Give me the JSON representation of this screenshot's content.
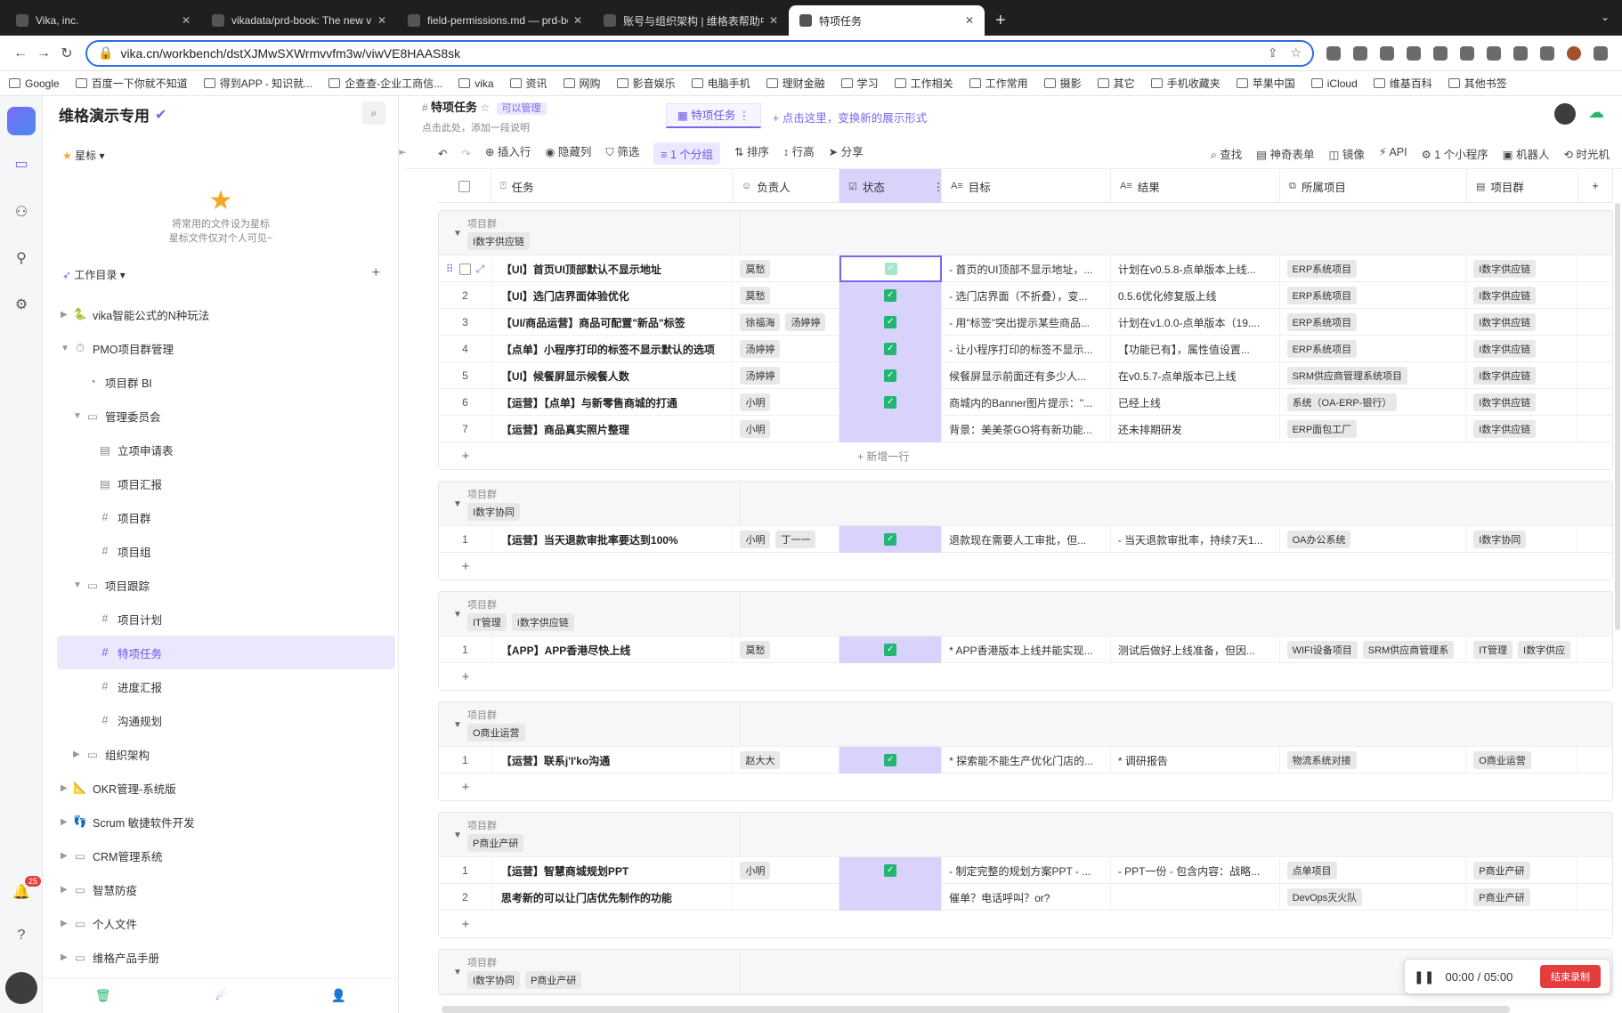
{
  "browser": {
    "tabs": [
      {
        "title": "Vika, inc.",
        "active": false
      },
      {
        "title": "vikadata/prd-book: The new vi",
        "active": false
      },
      {
        "title": "field-permissions.md — prd-bo",
        "active": false
      },
      {
        "title": "账号与组织架构 | 维格表帮助中心",
        "active": false
      },
      {
        "title": "特项任务",
        "active": true
      }
    ],
    "url": "vika.cn/workbench/dstXJMwSXWrmvvfm3w/viwVE8HAAS8sk",
    "bookmarks": [
      "Google",
      "百度一下你就不知道",
      "得到APP - 知识就...",
      "企查查-企业工商信...",
      "vika",
      "资讯",
      "网购",
      "影音娱乐",
      "电脑手机",
      "理财金融",
      "学习",
      "工作相关",
      "工作常用",
      "摄影",
      "其它",
      "手机收藏夹",
      "苹果中国",
      "iCloud",
      "维基百科",
      "其他书签"
    ]
  },
  "sidebar": {
    "space_name": "维格演示专用",
    "star_label": "星标",
    "star_tip_line1": "将常用的文件设为星标",
    "star_tip_line2": "星标文件仅对个人可见~",
    "catalog_label": "工作目录",
    "notification_count": "25",
    "tree": [
      {
        "label": "vika智能公式的N种玩法",
        "level": 0,
        "caret": "▶",
        "icon": "🐍"
      },
      {
        "label": "PMO项目群管理",
        "level": 0,
        "caret": "▼",
        "icon": "⏱"
      },
      {
        "label": "项目群 BI",
        "level": 1,
        "caret": "",
        "icon": "◔"
      },
      {
        "label": "管理委员会",
        "level": 1,
        "caret": "▼",
        "icon": "▭"
      },
      {
        "label": "立项申请表",
        "level": 2,
        "caret": "",
        "icon": "▤"
      },
      {
        "label": "项目汇报",
        "level": 2,
        "caret": "",
        "icon": "▤"
      },
      {
        "label": "项目群",
        "level": 2,
        "caret": "",
        "icon": "#"
      },
      {
        "label": "项目组",
        "level": 2,
        "caret": "",
        "icon": "#"
      },
      {
        "label": "项目跟踪",
        "level": 1,
        "caret": "▼",
        "icon": "▭"
      },
      {
        "label": "项目计划",
        "level": 2,
        "caret": "",
        "icon": "#"
      },
      {
        "label": "特项任务",
        "level": 2,
        "caret": "",
        "icon": "#"
      },
      {
        "label": "进度汇报",
        "level": 2,
        "caret": "",
        "icon": "#"
      },
      {
        "label": "沟通规划",
        "level": 2,
        "caret": "",
        "icon": "#"
      },
      {
        "label": "组织架构",
        "level": 1,
        "caret": "▶",
        "icon": "▭"
      },
      {
        "label": "OKR管理-系统版",
        "level": 0,
        "caret": "▶",
        "icon": "📐"
      },
      {
        "label": "Scrum 敏捷软件开发",
        "level": 0,
        "caret": "▶",
        "icon": "👣"
      },
      {
        "label": "CRM管理系统",
        "level": 0,
        "caret": "▶",
        "icon": "▭"
      },
      {
        "label": "智慧防疫",
        "level": 0,
        "caret": "▶",
        "icon": "▭"
      },
      {
        "label": "个人文件",
        "level": 0,
        "caret": "▶",
        "icon": "▭"
      },
      {
        "label": "维格产品手册",
        "level": 0,
        "caret": "▶",
        "icon": "▭"
      }
    ]
  },
  "view": {
    "datasheet_name": "特项任务",
    "permission": "可以管理",
    "description": "点击此处，添加一段说明",
    "view_tab": "特项任务",
    "add_view": "+ 点击这里，变换新的展示形式"
  },
  "toolbar": {
    "left": [
      "插入行",
      "隐藏列",
      "筛选",
      "1 个分组",
      "排序",
      "行高",
      "分享"
    ],
    "right": [
      "查找",
      "神奇表单",
      "镜像",
      "API",
      "1 个小程序",
      "机器人",
      "时光机"
    ]
  },
  "columns": [
    "任务",
    "负责人",
    "状态",
    "目标",
    "结果",
    "所属项目",
    "项目群"
  ],
  "group_label": "项目群",
  "add_row_label": "+ 新增一行",
  "groups": [
    {
      "tags": [
        "I数字供应链"
      ],
      "rows": [
        {
          "num": "",
          "task": "【UI】首页UI顶部默认不显示地址",
          "owners": [
            "莫愁"
          ],
          "done": true,
          "goal": "- 首页的UI顶部不显示地址，...",
          "result": "计划在v0.5.8-点单版本上线...",
          "projects": [
            "ERP系统项目"
          ],
          "pg": [
            "I数字供应链"
          ],
          "focus": true
        },
        {
          "num": "2",
          "task": "【UI】选门店界面体验优化",
          "owners": [
            "莫愁"
          ],
          "done": true,
          "goal": "- 选门店界面（不折叠），变...",
          "result": "0.5.6优化修复版上线",
          "projects": [
            "ERP系统项目"
          ],
          "pg": [
            "I数字供应链"
          ]
        },
        {
          "num": "3",
          "task": "【UI/商品运营】商品可配置\"新品\"标签",
          "owners": [
            "徐福海",
            "汤婷婷"
          ],
          "done": true,
          "goal": "- 用\"标签\"突出提示某些商品...",
          "result": "计划在v1.0.0-点单版本（19....",
          "projects": [
            "ERP系统项目"
          ],
          "pg": [
            "I数字供应链"
          ]
        },
        {
          "num": "4",
          "task": "【点单】小程序打印的标签不显示默认的选项",
          "owners": [
            "汤婷婷"
          ],
          "done": true,
          "goal": "- 让小程序打印的标签不显示...",
          "result": "【功能已有】，属性值设置...",
          "projects": [
            "ERP系统项目"
          ],
          "pg": [
            "I数字供应链"
          ]
        },
        {
          "num": "5",
          "task": "【UI】候餐屏显示候餐人数",
          "owners": [
            "汤婷婷"
          ],
          "done": true,
          "goal": " 候餐屏显示前面还有多少人...",
          "result": "在v0.5.7-点单版本已上线",
          "projects": [
            "SRM供应商管理系统项目"
          ],
          "pg": [
            "I数字供应链"
          ]
        },
        {
          "num": "6",
          "task": "【运营】【点单】与新零售商城的打通",
          "owners": [
            "小明"
          ],
          "done": true,
          "goal": "商城内的Banner图片提示：\"...",
          "result": "已经上线",
          "projects": [
            "系统（OA-ERP-银行）"
          ],
          "pg": [
            "I数字供应链"
          ]
        },
        {
          "num": "7",
          "task": "【运营】商品真实照片整理",
          "owners": [
            "小明"
          ],
          "done": false,
          "goal": "背景：美美茶GO将有新功能...",
          "result": "还未排期研发",
          "projects": [
            "ERP面包工厂"
          ],
          "pg": [
            "I数字供应链"
          ]
        }
      ],
      "show_new_row": true
    },
    {
      "tags": [
        "I数字协同"
      ],
      "rows": [
        {
          "num": "1",
          "task": "【运营】当天退款审批率要达到100%",
          "owners": [
            "小明",
            "丁一一"
          ],
          "done": true,
          "goal": "退款现在需要人工审批，但...",
          "result": "- 当天退款审批率，持续7天1...",
          "projects": [
            "OA办公系统"
          ],
          "pg": [
            "I数字协同"
          ]
        }
      ]
    },
    {
      "tags": [
        "IT管理",
        "I数字供应链"
      ],
      "rows": [
        {
          "num": "1",
          "task": "【APP】APP香港尽快上线",
          "owners": [
            "莫愁"
          ],
          "done": true,
          "goal": "* APP香港版本上线并能实现...",
          "result": "测试后做好上线准备，但因...",
          "projects": [
            "WIFI设备项目",
            "SRM供应商管理系"
          ],
          "pg": [
            "IT管理",
            "I数字供应"
          ]
        }
      ]
    },
    {
      "tags": [
        "O商业运营"
      ],
      "rows": [
        {
          "num": "1",
          "task": "【运营】联系j'I'ko沟通",
          "owners": [
            "赵大大"
          ],
          "done": true,
          "goal": "* 探索能不能生产优化门店的...",
          "result": "* 调研报告",
          "projects": [
            "物流系统对接"
          ],
          "pg": [
            "O商业运营"
          ]
        }
      ]
    },
    {
      "tags": [
        "P商业产研"
      ],
      "rows": [
        {
          "num": "1",
          "task": "【运营】智慧商城规划PPT",
          "owners": [
            "小明"
          ],
          "done": true,
          "goal": "- 制定完整的规划方案PPT - ...",
          "result": "- PPT一份 - 包含内容：战略...",
          "projects": [
            "点单项目"
          ],
          "pg": [
            "P商业产研"
          ]
        },
        {
          "num": "2",
          "task": "思考新的可以让门店优先制作的功能",
          "owners": [],
          "done": false,
          "goal": "催单？电话呼叫？or?",
          "result": "",
          "projects": [
            "DevOps灭火队"
          ],
          "pg": [
            "P商业产研"
          ]
        }
      ]
    },
    {
      "tags": [
        "I数字协同",
        "P商业产研"
      ],
      "rows": []
    }
  ],
  "recorder": {
    "time": "00:00 / 05:00",
    "end_label": "结束录制"
  }
}
